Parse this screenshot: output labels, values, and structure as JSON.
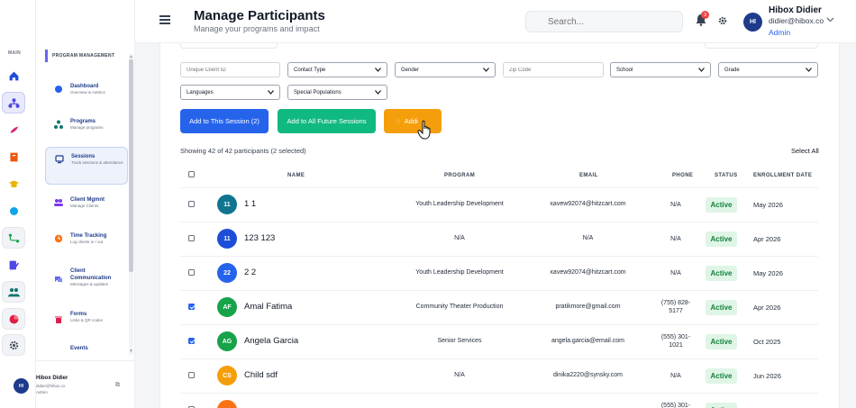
{
  "colors": {
    "primary": "#2563eb",
    "success": "#10b981",
    "warning": "#f59e0b",
    "navy": "#1e3a8a"
  },
  "rail": {
    "section_label": "MAIN",
    "icons": [
      "home-icon",
      "network-icon",
      "brush-icon",
      "book-icon",
      "graduation-icon",
      "circle-icon",
      "flow-icon",
      "document-edit-icon",
      "people-icon",
      "pie-chart-icon",
      "settings-icon"
    ]
  },
  "sidebar": {
    "section": "PROGRAM MANAGEMENT",
    "items": [
      {
        "title": "Dashboard",
        "sub": "Overview & metrics"
      },
      {
        "title": "Programs",
        "sub": "Manage programs"
      },
      {
        "title": "Sessions",
        "sub": "Track sessions & attendance"
      },
      {
        "title": "Client Mgmnt",
        "sub": "Manage Clients"
      },
      {
        "title": "Time Tracking",
        "sub": "Log clients in / out"
      },
      {
        "title": "Client Communication",
        "sub": "Messages & updates"
      },
      {
        "title": "Forms",
        "sub": "Links & QR codes"
      },
      {
        "title": "Events",
        "sub": ""
      }
    ],
    "footer": {
      "initials": "HI",
      "name": "Hibox Didier",
      "email": "didier@hibox.co",
      "role": "Admin"
    }
  },
  "header": {
    "title": "Manage Participants",
    "subtitle": "Manage your programs and impact",
    "search_placeholder": "Search...",
    "notifications": "3",
    "user": {
      "initials": "HI",
      "name": "Hibox Didier",
      "email": "didier@hibox.co",
      "role": "Admin"
    }
  },
  "filters": {
    "client_id_placeholder": "Unique Client ID",
    "contact_type": "Contact Type",
    "gender": "Gender",
    "zip_placeholder": "Zip Code",
    "school": "School",
    "grade": "Grade",
    "languages": "Languages",
    "special_populations": "Special Populations"
  },
  "actions": {
    "add_session": "Add to This Session (2)",
    "add_future": "Add to All Future Sessions",
    "adding": "Addi"
  },
  "summary": {
    "showing": "Showing 42 of 42 participants (2 selected)",
    "select_all": "Select All"
  },
  "table": {
    "headers": {
      "name": "NAME",
      "program": "PROGRAM",
      "email": "EMAIL",
      "phone": "PHONE",
      "status": "STATUS",
      "enrollment": "ENROLLMENT DATE"
    },
    "rows": [
      {
        "checked": false,
        "initials": "11",
        "color": "#0e7490",
        "name": "1 1",
        "program": "Youth Leadership Development",
        "email": "xavew92074@hitzcart.com",
        "phone": "N/A",
        "status": "Active",
        "date": "May 2026"
      },
      {
        "checked": false,
        "initials": "11",
        "color": "#1d4ed8",
        "name": "123 123",
        "program": "N/A",
        "email": "N/A",
        "phone": "N/A",
        "status": "Active",
        "date": "Apr 2026"
      },
      {
        "checked": false,
        "initials": "22",
        "color": "#2563eb",
        "name": "2 2",
        "program": "Youth Leadership Development",
        "email": "xavew92074@hitzcart.com",
        "phone": "N/A",
        "status": "Active",
        "date": "May 2026"
      },
      {
        "checked": true,
        "initials": "AF",
        "color": "#16a34a",
        "name": "Amal Fatima",
        "program": "Community Theater Production",
        "email": "pratikmore@gmail.com",
        "phone": "(755) 828-5177",
        "status": "Active",
        "date": "Apr 2026"
      },
      {
        "checked": true,
        "initials": "AG",
        "color": "#16a34a",
        "name": "Angela Garcia",
        "program": "Senior Services",
        "email": "angela.garcia@email.com",
        "phone": "(555) 301-1021",
        "status": "Active",
        "date": "Oct 2025"
      },
      {
        "checked": false,
        "initials": "CS",
        "color": "#f59e0b",
        "name": "Child sdf",
        "program": "N/A",
        "email": "dinika2220@synsky.com",
        "phone": "N/A",
        "status": "Active",
        "date": "Jun 2026"
      },
      {
        "checked": false,
        "initials": "",
        "color": "#f97316",
        "name": "",
        "program": "",
        "email": "",
        "phone": "(555) 301-",
        "status": "Active",
        "date": ""
      }
    ]
  }
}
